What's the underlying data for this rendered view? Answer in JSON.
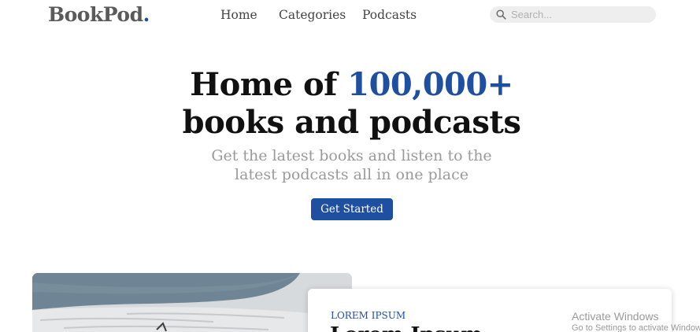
{
  "header": {
    "logo_text": "BookPod",
    "logo_dot": ".",
    "nav": [
      {
        "label": "Home"
      },
      {
        "label": "Categories"
      },
      {
        "label": "Podcasts"
      }
    ],
    "search": {
      "placeholder": "Search...",
      "icon": "search-icon"
    }
  },
  "hero": {
    "title_line1_prefix": "Home of ",
    "title_line1_accent": "100,000+",
    "title_line2": "books and podcasts",
    "subtitle_line1": "Get the latest books and listen to the",
    "subtitle_line2": "latest podcasts all in one place",
    "cta_label": "Get Started"
  },
  "feature": {
    "kicker": "LOREM IPSUM",
    "title": "Lorem Ipsum"
  },
  "watermark": {
    "line1": "Activate Windows",
    "line2": "Go to Settings to activate Windows."
  },
  "colors": {
    "accent": "#1f4fa0",
    "logo": "#5a5a5a",
    "subtitle": "#9a9a9a",
    "search_bg": "#eeeeee"
  }
}
